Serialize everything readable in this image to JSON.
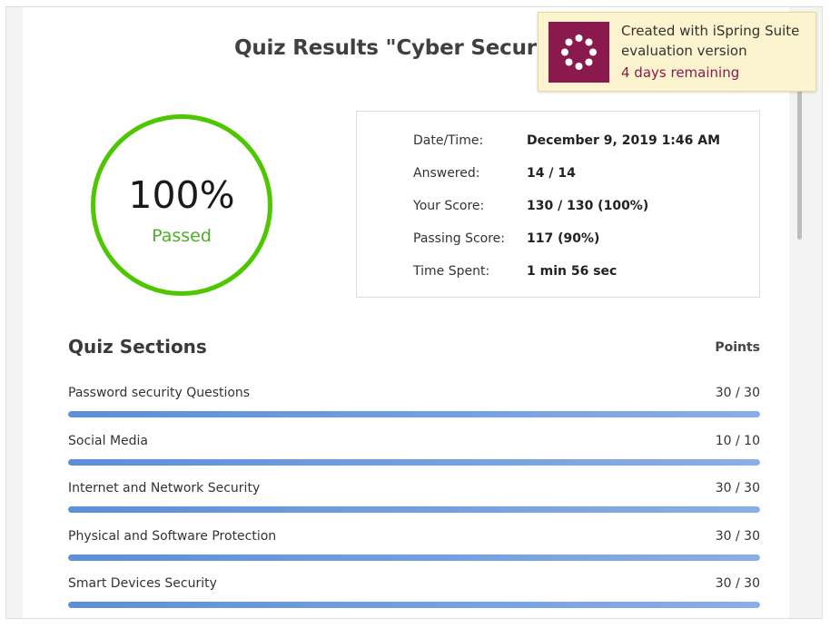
{
  "quiz": {
    "title": "Quiz Results \"Cyber Security\"",
    "score_percent": "100%",
    "status": "Passed",
    "ring_color": "#4cc700"
  },
  "stats": [
    {
      "label": "Date/Time:",
      "value": "December 9, 2019 1:46 AM"
    },
    {
      "label": "Answered:",
      "value": "14 / 14"
    },
    {
      "label": "Your Score:",
      "value": "130 / 130 (100%)"
    },
    {
      "label": "Passing Score:",
      "value": "117 (90%)"
    },
    {
      "label": "Time Spent:",
      "value": "1 min 56 sec"
    }
  ],
  "sections": {
    "heading": "Quiz Sections",
    "points_heading": "Points",
    "bar_color": "#5b8fd8",
    "items": [
      {
        "name": "Password security Questions",
        "points": "30 / 30",
        "fill_fraction": 1.0
      },
      {
        "name": "Social Media",
        "points": "10 / 10",
        "fill_fraction": 1.0
      },
      {
        "name": "Internet and Network Security",
        "points": "30 / 30",
        "fill_fraction": 1.0
      },
      {
        "name": "Physical and Software Protection",
        "points": "30 / 30",
        "fill_fraction": 1.0
      },
      {
        "name": "Smart Devices Security",
        "points": "30 / 30",
        "fill_fraction": 1.0
      }
    ]
  },
  "toast": {
    "line1": "Created with iSpring Suite",
    "line2": "evaluation version",
    "remaining": "4 days remaining",
    "logo_icon": "ispring-logo-icon",
    "accent_color": "#8a1a4d"
  }
}
